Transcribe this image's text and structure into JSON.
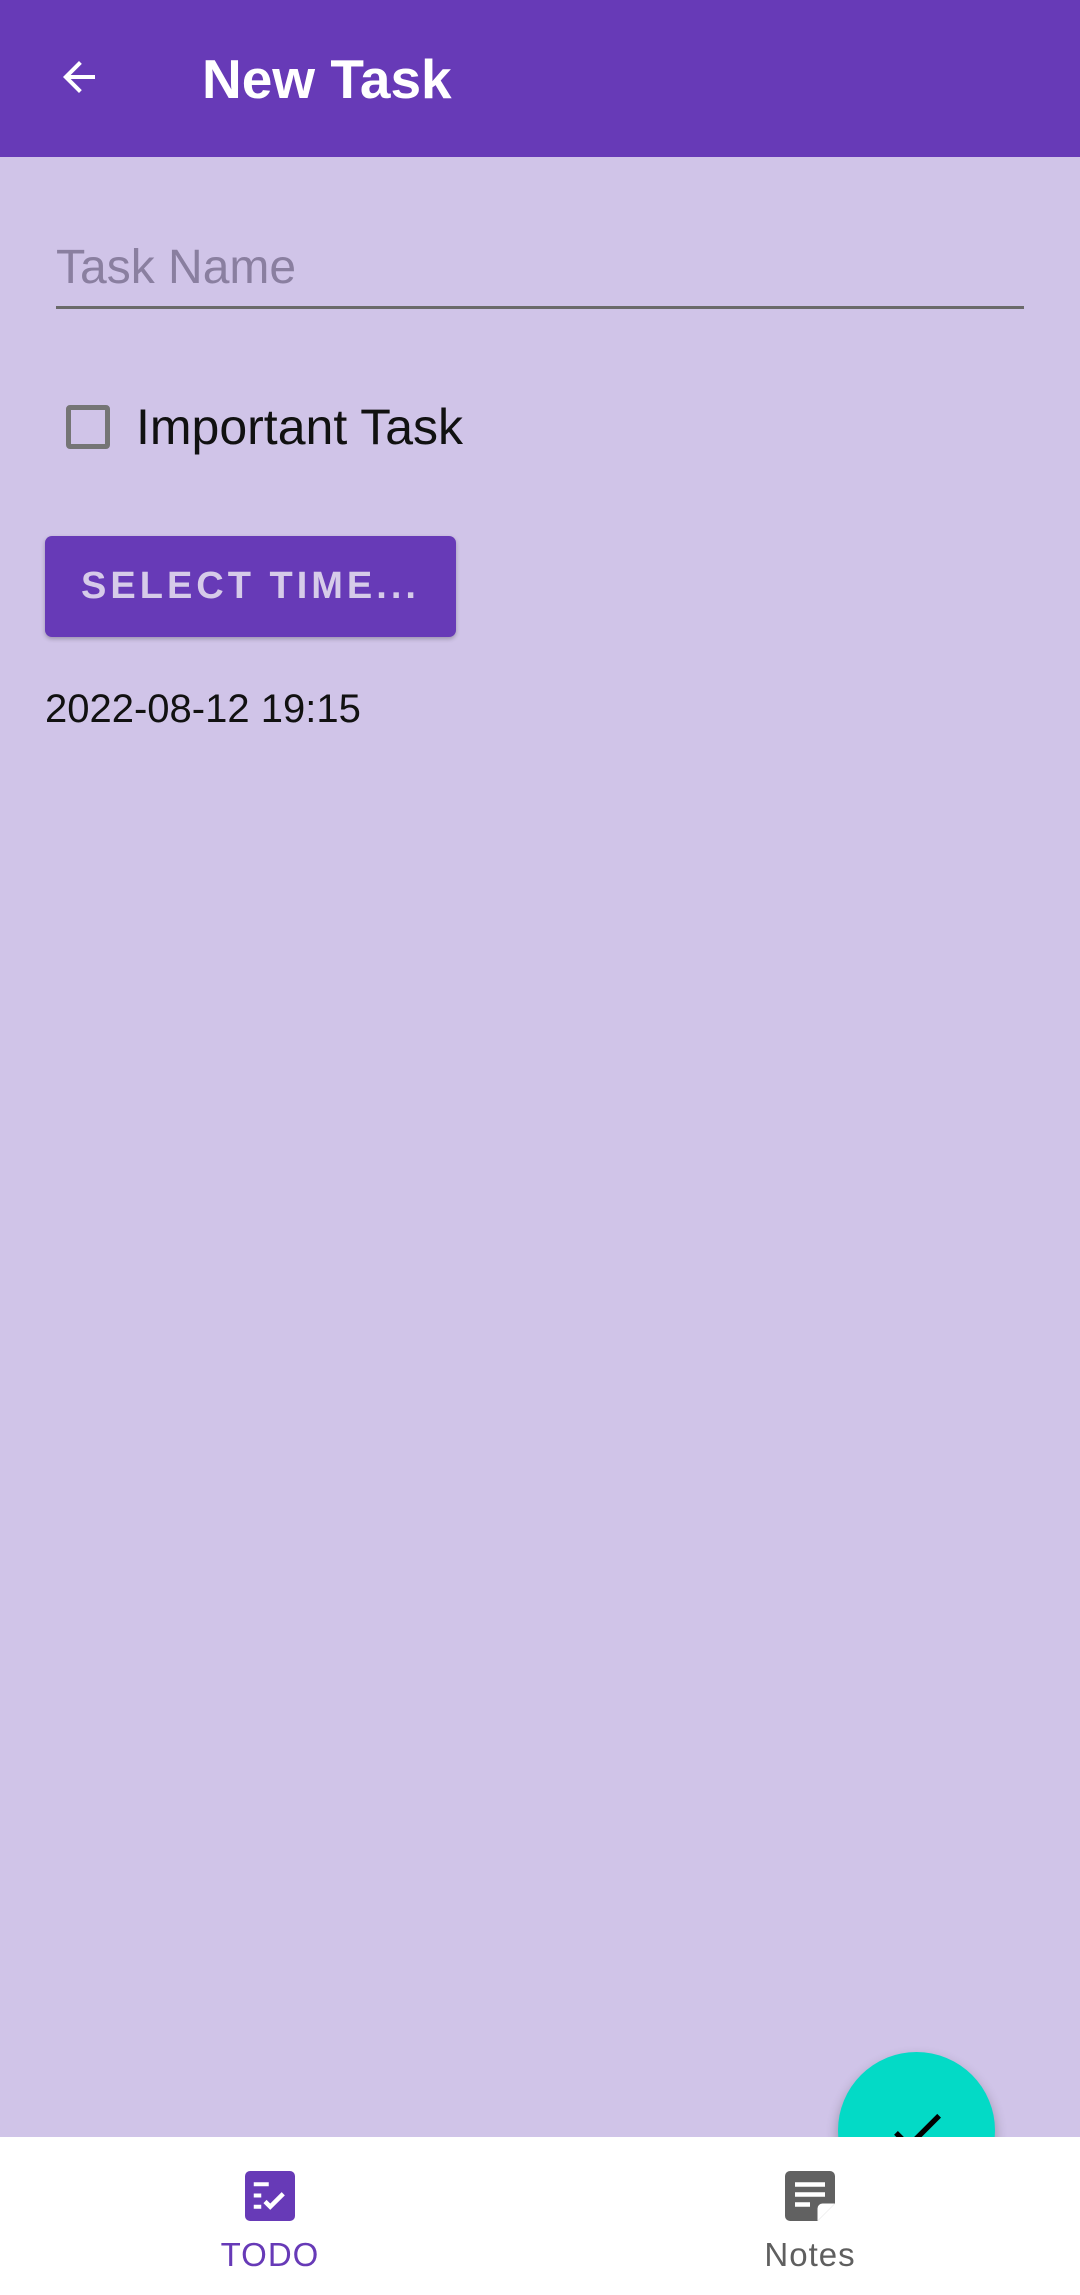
{
  "appbar": {
    "title": "New Task",
    "back_icon": "arrow-left-icon",
    "color": "#673ab7"
  },
  "form": {
    "task_name_placeholder": "Task Name",
    "task_name_value": "",
    "important_label": "Important Task",
    "important_checked": false,
    "select_time_label": "SELECT TIME...",
    "datetime_value": "2022-08-12 19:15"
  },
  "fab": {
    "icon": "check-icon",
    "color": "#03dac6"
  },
  "bottom_nav": {
    "items": [
      {
        "label": "TODO",
        "icon": "checklist-icon",
        "active": true
      },
      {
        "label": "Notes",
        "icon": "note-icon",
        "active": false
      }
    ]
  },
  "colors": {
    "background": "#d0c4e8",
    "primary": "#673ab7",
    "accent": "#03dac6"
  }
}
